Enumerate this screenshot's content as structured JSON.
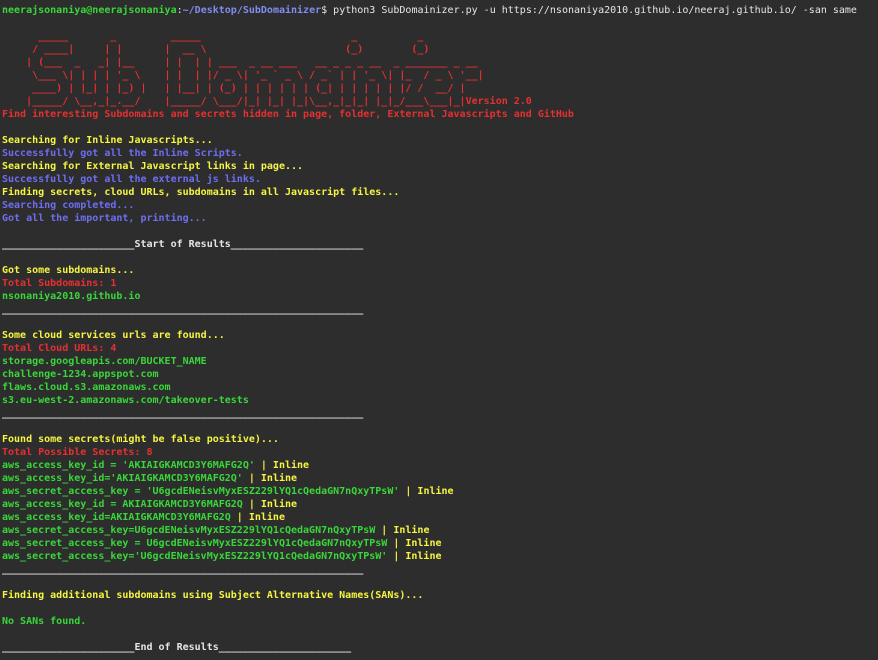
{
  "prompt": {
    "user_host": "neerajsonaniya@neerajsonaniya",
    "colon": ":",
    "path": "~/Desktop/SubDomainizer",
    "dollar": "$ ",
    "command": "python3 SubDomainizer.py -u https://nsonaniya2010.github.io/neeraj.github.io/ -san same"
  },
  "banner": {
    "ascii": "      _____       _         _____                         _          _\n     / ____|     | |       |  __ \\                       (_)        (_)\n    | (___  _   _| |__     | |  | | ___  _ __ ___   __ _ _ _ __  _ _______ _ __\n     \\___ \\| | | | '_ \\    | |  | |/ _ \\| '_ ` _ \\ / _` | | '_ \\| |_  / _ \\ '__|\n     ____) | |_| | |_) |   | |__| | (_) | | | | | | (_| | | | | | |/ /  __/ |\n    |_____/ \\__,_|_.__/    |_____/ \\___/|_| |_| |_|\\__,_|_|_| |_|_/___\\___|_|",
    "version": "Version 2.0",
    "tagline": "Find interesting Subdomains and secrets hidden in page, folder, External Javascripts and GitHub"
  },
  "progress": [
    {
      "text": "Searching for Inline Javascripts...",
      "color": "yellow"
    },
    {
      "text": "Successfully got all the Inline Scripts.",
      "color": "blue"
    },
    {
      "text": "Searching for External Javascript links in page...",
      "color": "yellow"
    },
    {
      "text": "Successfully got all the external js links.",
      "color": "blue"
    },
    {
      "text": "Finding secrets, cloud URLs, subdomains in all Javascript files...",
      "color": "yellow"
    },
    {
      "text": "Searching completed...",
      "color": "blue"
    },
    {
      "text": "Got all the important, printing...",
      "color": "blue"
    }
  ],
  "start_results": "______________________Start of Results______________________",
  "subdomains": {
    "heading": "Got some subdomains...",
    "total": "Total Subdomains: 1",
    "items": [
      "nsonaniya2010.github.io"
    ]
  },
  "divider": "____________________________________________________________",
  "cloud": {
    "heading": "Some cloud services urls are found...",
    "total": "Total Cloud URLs: 4",
    "items": [
      "storage.googleapis.com/BUCKET_NAME",
      "challenge-1234.appspot.com",
      "flaws.cloud.s3.amazonaws.com",
      "s3.eu-west-2.amazonaws.com/takeover-tests"
    ]
  },
  "secrets": {
    "heading": "Found some secrets(might be false positive)...",
    "total": "Total Possible Secrets: 8",
    "items": [
      {
        "text": "aws_access_key_id = 'AKIAIGKAMCD3Y6MAFG2Q'",
        "tag": " | Inline"
      },
      {
        "text": "aws_access_key_id='AKIAIGKAMCD3Y6MAFG2Q'",
        "tag": " | Inline"
      },
      {
        "text": "aws_secret_access_key = 'U6gcdENeisvMyxESZ229lYQ1cQedaGN7nQxyTPsW'",
        "tag": " | Inline"
      },
      {
        "text": "aws_access_key_id = AKIAIGKAMCD3Y6MAFG2Q",
        "tag": " | Inline"
      },
      {
        "text": "aws_access_key_id=AKIAIGKAMCD3Y6MAFG2Q",
        "tag": " | Inline"
      },
      {
        "text": "aws_secret_access_key=U6gcdENeisvMyxESZ229lYQ1cQedaGN7nQxyTPsW",
        "tag": " | Inline"
      },
      {
        "text": "aws_secret_access_key = U6gcdENeisvMyxESZ229lYQ1cQedaGN7nQxyTPsW",
        "tag": " | Inline"
      },
      {
        "text": "aws_secret_access_key='U6gcdENeisvMyxESZ229lYQ1cQedaGN7nQxyTPsW'",
        "tag": " | Inline"
      }
    ]
  },
  "sans": {
    "heading": "Finding additional subdomains using Subject Alternative Names(SANs)...",
    "result": "No SANs found."
  },
  "end_results": "______________________End of Results______________________",
  "colors": {
    "background": "#2d2d2d",
    "green": "#39d739",
    "blue": "#6e6ef0",
    "red": "#e63030",
    "yellow": "#f5f542"
  }
}
